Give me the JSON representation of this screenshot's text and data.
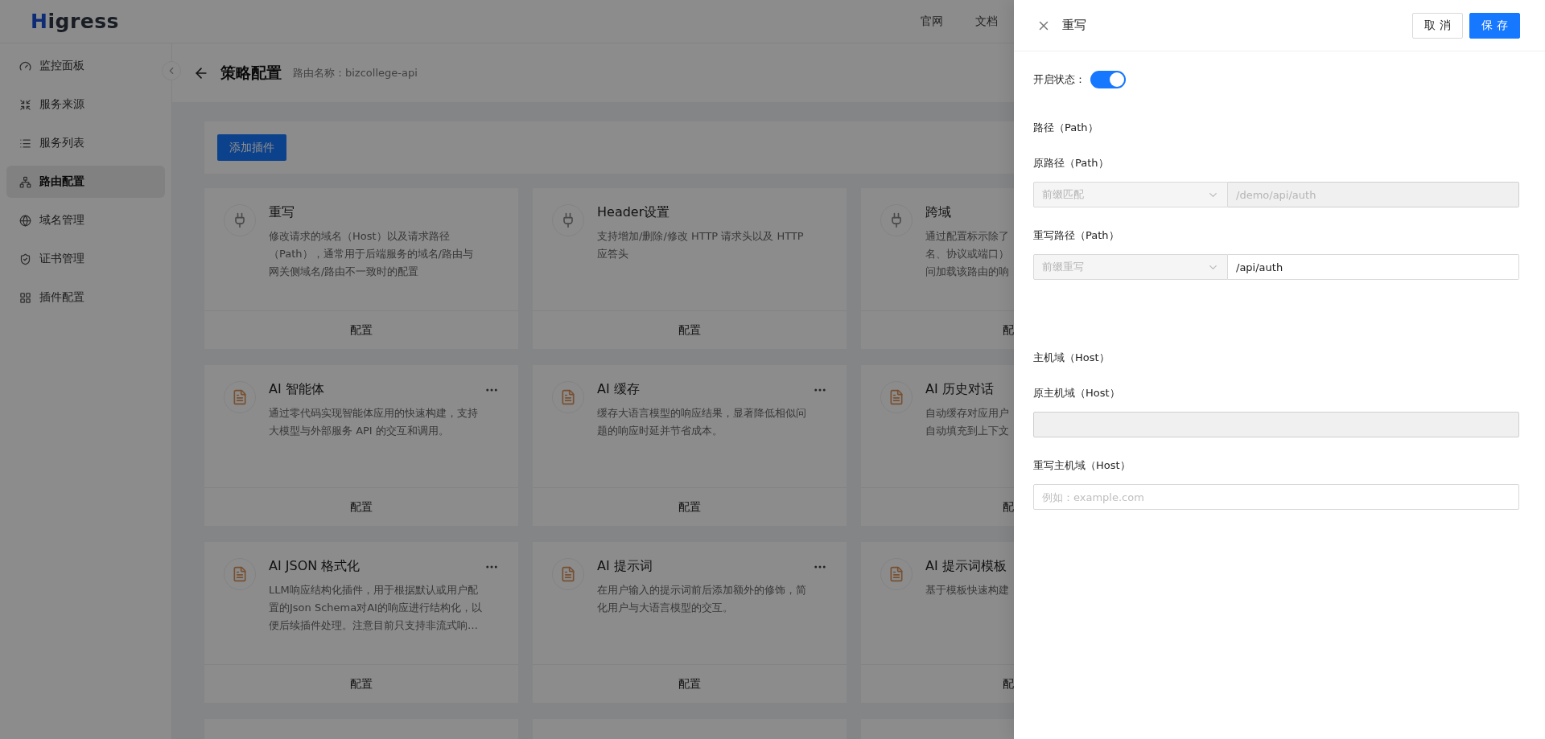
{
  "header": {
    "logo": "Higress",
    "nav": [
      "官网",
      "文档"
    ]
  },
  "sidebar": {
    "items": [
      {
        "label": "监控面板",
        "selected": false
      },
      {
        "label": "服务来源",
        "selected": false
      },
      {
        "label": "服务列表",
        "selected": false
      },
      {
        "label": "路由配置",
        "selected": true
      },
      {
        "label": "域名管理",
        "selected": false
      },
      {
        "label": "证书管理",
        "selected": false
      },
      {
        "label": "插件配置",
        "selected": false
      }
    ]
  },
  "page": {
    "title": "策略配置",
    "subtitle": "路由名称：bizcollege-api",
    "add_button": "添加插件"
  },
  "cards": [
    {
      "kind": "builtin",
      "title": "重写",
      "description": [
        "修改请求的域名（Host）以及请求路径",
        "（Path），通常用于后端服务的域名/路由与",
        "网关侧域名/路由不一致时的配置"
      ],
      "has_menu": false,
      "footer": "配置",
      "clipped": false
    },
    {
      "kind": "builtin",
      "title": "Header设置",
      "description": [
        "支持增加/删除/修改 HTTP 请求头以及 HTTP",
        "应答头"
      ],
      "has_menu": false,
      "footer": "配置",
      "clipped": false
    },
    {
      "kind": "builtin",
      "title": "跨域",
      "description": [
        "通过配置标示除了",
        "名、协议或端口）",
        "问加载该路由的响"
      ],
      "footer": "配",
      "clipped": true
    },
    {
      "kind": "ai",
      "title": "AI 智能体",
      "description": [
        "通过零代码实现智能体应用的快速构建，支持",
        "大模型与外部服务 API 的交互和调用。"
      ],
      "has_menu": true,
      "footer": "配置",
      "clipped": false
    },
    {
      "kind": "ai",
      "title": "AI 缓存",
      "description": [
        "缓存大语言模型的响应结果，显著降低相似问",
        "题的响应时延并节省成本。"
      ],
      "has_menu": true,
      "footer": "配置",
      "clipped": false
    },
    {
      "kind": "ai",
      "title": "AI 历史对话",
      "description": [
        "自动缓存对应用户",
        "自动填充到上下文"
      ],
      "footer": "配",
      "clipped": true
    },
    {
      "kind": "ai",
      "title": "AI JSON 格式化",
      "description": [
        "LLM响应结构化插件，用于根据默认或用户配",
        "置的Json Schema对AI的响应进行结构化，以",
        "便后续插件处理。注意目前只支持非流式响…"
      ],
      "has_menu": true,
      "footer": "配置",
      "clipped": false
    },
    {
      "kind": "ai",
      "title": "AI 提示词",
      "description": [
        "在用户输入的提示词前后添加额外的修饰，简",
        "化用户与大语言模型的交互。"
      ],
      "has_menu": true,
      "footer": "配置",
      "clipped": false
    },
    {
      "kind": "ai",
      "title": "AI 提示词模板",
      "description": [
        "基于模板快速构建"
      ],
      "footer": "配",
      "clipped": true
    },
    {
      "kind": "stub"
    },
    {
      "kind": "stub"
    },
    {
      "kind": "stub"
    }
  ],
  "drawer": {
    "title": "重写",
    "buttons": [
      {
        "label": "取消",
        "kind": "default"
      },
      {
        "label": "保存",
        "kind": "primary"
      }
    ],
    "enabled_label": "开启状态：",
    "enabled": true,
    "sections": [
      {
        "heading": "路径（Path）",
        "fields": [
          {
            "label": "原路径（Path）",
            "select": {
              "value": "前缀匹配",
              "disabled": true
            },
            "input": {
              "value": "/demo/api/auth",
              "disabled": true
            }
          },
          {
            "label": "重写路径（Path）",
            "select": {
              "value": "前缀重写",
              "disabled": true
            },
            "input": {
              "value": "/api/auth",
              "disabled": false
            }
          }
        ]
      },
      {
        "heading": "主机域（Host）",
        "fields": [
          {
            "label": "原主机域（Host）",
            "input": {
              "disabled": true
            }
          },
          {
            "label": "重写主机域（Host）",
            "input": {
              "placeholder": "例如：example.com",
              "disabled": false
            }
          }
        ]
      }
    ]
  }
}
